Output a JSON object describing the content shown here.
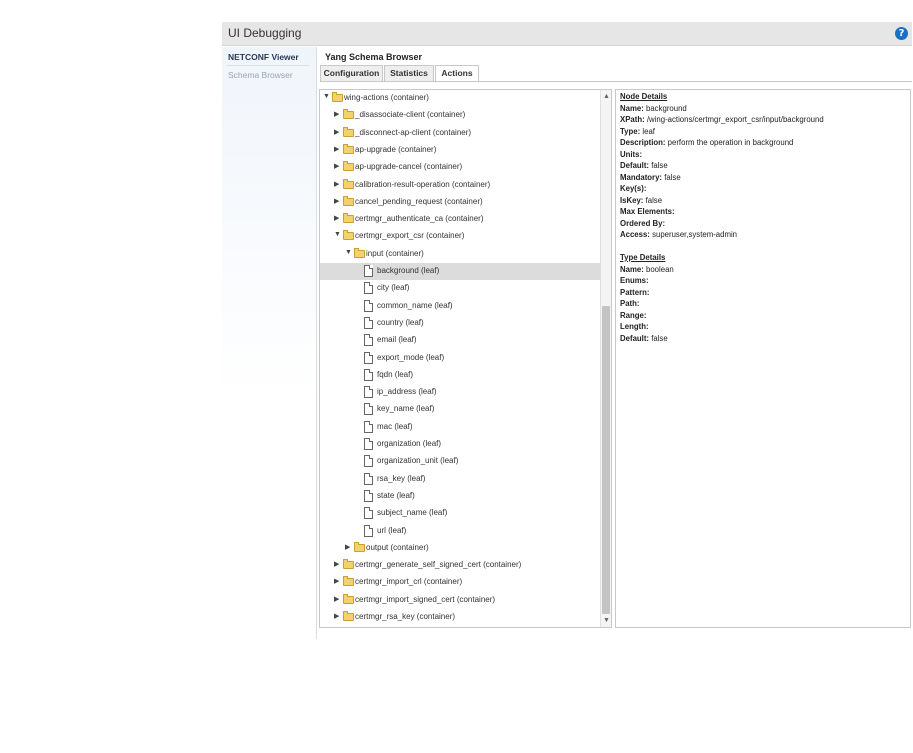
{
  "window": {
    "title": "UI Debugging",
    "help_icon": "?"
  },
  "sidebar": {
    "items": [
      {
        "label": "NETCONF Viewer"
      },
      {
        "label": "Schema Browser"
      }
    ]
  },
  "content": {
    "title": "Yang Schema Browser",
    "tabs": [
      {
        "label": "Configuration"
      },
      {
        "label": "Statistics"
      },
      {
        "label": "Actions"
      }
    ],
    "selected_tab": "Actions"
  },
  "tree": {
    "nodes": [
      {
        "label": "wing-actions (container)",
        "type": "folder",
        "level": 0,
        "expanded": true
      },
      {
        "label": "_disassociate-client (container)",
        "type": "folder",
        "level": 1,
        "expanded": false
      },
      {
        "label": "_disconnect-ap-client (container)",
        "type": "folder",
        "level": 1,
        "expanded": false
      },
      {
        "label": "ap-upgrade (container)",
        "type": "folder",
        "level": 1,
        "expanded": false
      },
      {
        "label": "ap-upgrade-cancel (container)",
        "type": "folder",
        "level": 1,
        "expanded": false
      },
      {
        "label": "calibration-result-operation (container)",
        "type": "folder",
        "level": 1,
        "expanded": false
      },
      {
        "label": "cancel_pending_request (container)",
        "type": "folder",
        "level": 1,
        "expanded": false
      },
      {
        "label": "certmgr_authenticate_ca (container)",
        "type": "folder",
        "level": 1,
        "expanded": false
      },
      {
        "label": "certmgr_export_csr (container)",
        "type": "folder",
        "level": 1,
        "expanded": true
      },
      {
        "label": "input (container)",
        "type": "folder",
        "level": 2,
        "expanded": true
      },
      {
        "label": "background (leaf)",
        "type": "leaf",
        "level": 3,
        "selected": true
      },
      {
        "label": "city (leaf)",
        "type": "leaf",
        "level": 3
      },
      {
        "label": "common_name (leaf)",
        "type": "leaf",
        "level": 3
      },
      {
        "label": "country (leaf)",
        "type": "leaf",
        "level": 3
      },
      {
        "label": "email (leaf)",
        "type": "leaf",
        "level": 3
      },
      {
        "label": "export_mode (leaf)",
        "type": "leaf",
        "level": 3
      },
      {
        "label": "fqdn (leaf)",
        "type": "leaf",
        "level": 3
      },
      {
        "label": "ip_address (leaf)",
        "type": "leaf",
        "level": 3
      },
      {
        "label": "key_name (leaf)",
        "type": "leaf",
        "level": 3
      },
      {
        "label": "mac (leaf)",
        "type": "leaf",
        "level": 3
      },
      {
        "label": "organization (leaf)",
        "type": "leaf",
        "level": 3
      },
      {
        "label": "organization_unit (leaf)",
        "type": "leaf",
        "level": 3
      },
      {
        "label": "rsa_key (leaf)",
        "type": "leaf",
        "level": 3
      },
      {
        "label": "state (leaf)",
        "type": "leaf",
        "level": 3
      },
      {
        "label": "subject_name (leaf)",
        "type": "leaf",
        "level": 3
      },
      {
        "label": "url (leaf)",
        "type": "leaf",
        "level": 3
      },
      {
        "label": "output (container)",
        "type": "folder",
        "level": 2,
        "expanded": false
      },
      {
        "label": "certmgr_generate_self_signed_cert (container)",
        "type": "folder",
        "level": 1,
        "expanded": false
      },
      {
        "label": "certmgr_import_crl (container)",
        "type": "folder",
        "level": 1,
        "expanded": false
      },
      {
        "label": "certmgr_import_signed_cert (container)",
        "type": "folder",
        "level": 1,
        "expanded": false
      },
      {
        "label": "certmgr_rsa_key (container)",
        "type": "folder",
        "level": 1,
        "expanded": false
      }
    ]
  },
  "node_details": {
    "heading": "Node Details",
    "fields": [
      {
        "key": "Name:",
        "value": " background"
      },
      {
        "key": "XPath:",
        "value": " /wing-actions/certmgr_export_csr/input/background"
      },
      {
        "key": "Type:",
        "value": " leaf"
      },
      {
        "key": "Description:",
        "value": " perform the operation in background"
      },
      {
        "key": "Units:",
        "value": ""
      },
      {
        "key": "Default:",
        "value": " false"
      },
      {
        "key": "Mandatory:",
        "value": " false"
      },
      {
        "key": "Key(s):",
        "value": ""
      },
      {
        "key": "IsKey:",
        "value": " false"
      },
      {
        "key": "Max Elements:",
        "value": ""
      },
      {
        "key": "Ordered By:",
        "value": ""
      },
      {
        "key": "Access:",
        "value": " superuser,system-admin"
      }
    ]
  },
  "type_details": {
    "heading": "Type Details",
    "fields": [
      {
        "key": "Name:",
        "value": " boolean"
      },
      {
        "key": "Enums:",
        "value": ""
      },
      {
        "key": "Pattern:",
        "value": ""
      },
      {
        "key": "Path:",
        "value": ""
      },
      {
        "key": "Range:",
        "value": ""
      },
      {
        "key": "Length:",
        "value": ""
      },
      {
        "key": "Default:",
        "value": " false"
      }
    ]
  },
  "colors": {
    "help": "#1a6fc7",
    "selected_row": "#dcdcdc",
    "folder": "#f1d26d"
  }
}
